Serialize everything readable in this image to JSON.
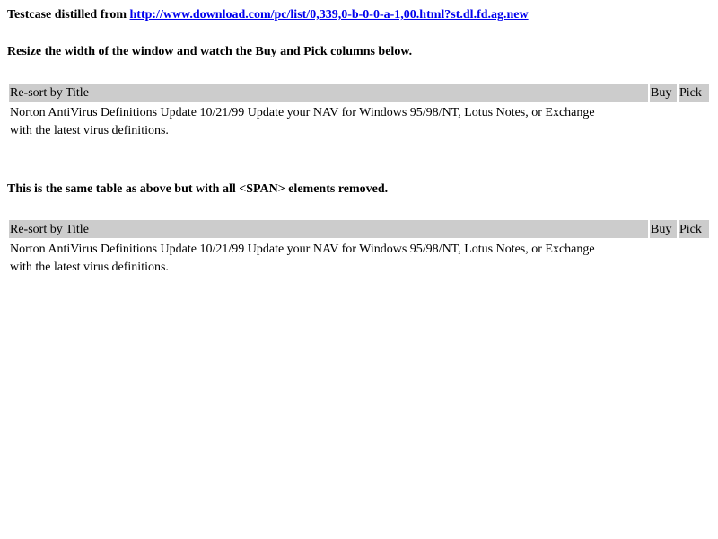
{
  "intro": {
    "prefix": "Testcase distilled from ",
    "link_text": "http://www.download.com/pc/list/0,339,0-b-0-0-a-1,00.html?st.dl.fd.ag.new"
  },
  "instructions": {
    "first": "Resize the width of the window and watch the Buy and Pick columns below.",
    "second": "This is the same table as above but with all <SPAN> elements removed."
  },
  "tables": [
    {
      "headers": {
        "title": "Re-sort by Title",
        "buy": "Buy",
        "pick": "Pick"
      },
      "row": {
        "description": "Norton AntiVirus Definitions Update 10/21/99 Update your NAV for Windows 95/98/NT, Lotus Notes, or Exchange with the latest virus definitions."
      }
    },
    {
      "headers": {
        "title": "Re-sort by Title",
        "buy": "Buy",
        "pick": "Pick"
      },
      "row": {
        "description": "Norton AntiVirus Definitions Update 10/21/99 Update your NAV for Windows 95/98/NT, Lotus Notes, or Exchange with the latest virus definitions."
      }
    }
  ]
}
